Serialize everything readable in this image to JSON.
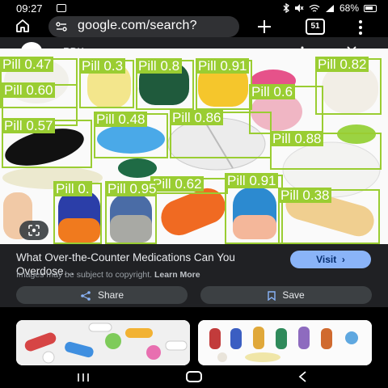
{
  "status": {
    "time": "09:27",
    "battery": "68%",
    "icons": [
      "photo-icon",
      "bluetooth-icon",
      "mute-icon",
      "wifi-icon",
      "signal-icon",
      "battery-icon"
    ]
  },
  "toolbar": {
    "url": "google.com/search?",
    "tab_count": "51",
    "icons": [
      "home-icon",
      "site-info-icon",
      "plus-icon",
      "tabs-icon",
      "menu-icon"
    ]
  },
  "viewer": {
    "site_name": "PBK",
    "icons": [
      "more-icon",
      "close-icon"
    ]
  },
  "photo": {
    "box_color": "#9acd32",
    "detections": [
      {
        "label": "Pill 0.47"
      },
      {
        "label": "Pill 0.3"
      },
      {
        "label": "Pill 0.8"
      },
      {
        "label": "Pill 0.91"
      },
      {
        "label": "Pill 0.82"
      },
      {
        "label": "Pill 0.60"
      },
      {
        "label": "Pill 0.6"
      },
      {
        "label": "Pill 0.57"
      },
      {
        "label": "Pill 0.48"
      },
      {
        "label": "Pill 0.86"
      },
      {
        "label": "Pill 0.88"
      },
      {
        "label": "Pill 0.62"
      },
      {
        "label": "Pill 0.91"
      },
      {
        "label": "Pill 0.38"
      },
      {
        "label": "Pill 0."
      },
      {
        "label": "Pill 0.95"
      }
    ],
    "lens_icon": "lens-icon"
  },
  "info": {
    "title": "What Over-the-Counter Medications Can You Overdose…",
    "copyright": "Images may be subject to copyright.",
    "learn_more": "Learn More",
    "visit_label": "Visit",
    "share_label": "Share",
    "save_label": "Save",
    "accent": "#8ab4f8"
  },
  "nav": {
    "icons": [
      "recents-icon",
      "home-nav-icon",
      "back-icon"
    ]
  }
}
